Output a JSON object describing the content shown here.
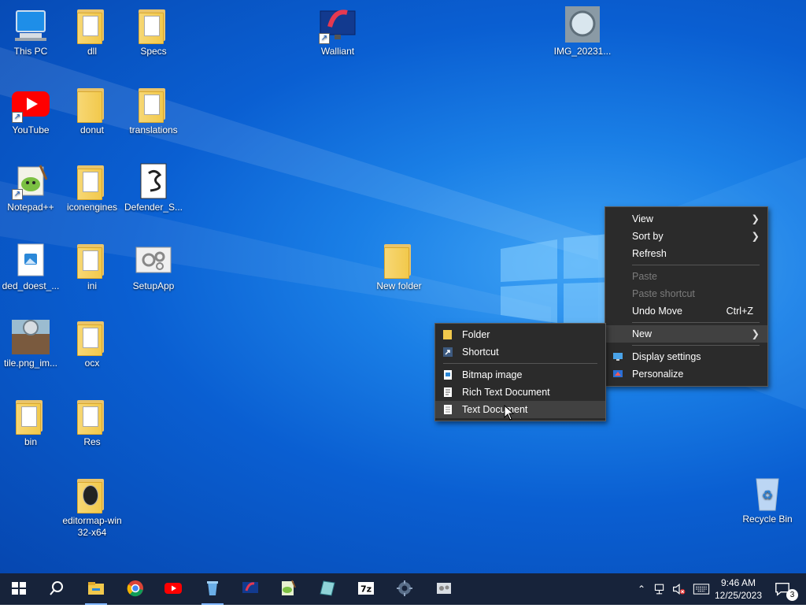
{
  "desktop": {
    "icons": [
      {
        "label": "This PC"
      },
      {
        "label": "dll"
      },
      {
        "label": "Specs"
      },
      {
        "label": "Walliant"
      },
      {
        "label": "IMG_20231..."
      },
      {
        "label": "YouTube"
      },
      {
        "label": "donut"
      },
      {
        "label": "translations"
      },
      {
        "label": "Notepad++"
      },
      {
        "label": "iconengines"
      },
      {
        "label": "Defender_S..."
      },
      {
        "label": "ded_doest_..."
      },
      {
        "label": "ini"
      },
      {
        "label": "SetupApp"
      },
      {
        "label": "New folder"
      },
      {
        "label": "tile.png_im..."
      },
      {
        "label": "ocx"
      },
      {
        "label": "bin"
      },
      {
        "label": "Res"
      },
      {
        "label": "editormap-win32-x64"
      },
      {
        "label": "Recycle Bin"
      }
    ]
  },
  "context_menu": {
    "items": [
      {
        "label": "View"
      },
      {
        "label": "Sort by"
      },
      {
        "label": "Refresh"
      },
      {
        "label": "Paste"
      },
      {
        "label": "Paste shortcut"
      },
      {
        "label": "Undo Move",
        "shortcut": "Ctrl+Z"
      },
      {
        "label": "New"
      },
      {
        "label": "Display settings"
      },
      {
        "label": "Personalize"
      }
    ]
  },
  "new_submenu": {
    "items": [
      {
        "label": "Folder"
      },
      {
        "label": "Shortcut"
      },
      {
        "label": "Bitmap image"
      },
      {
        "label": "Rich Text Document"
      },
      {
        "label": "Text Document"
      }
    ]
  },
  "taskbar": {
    "clock": {
      "time": "9:46 AM",
      "date": "12/25/2023"
    },
    "notification_count": "3",
    "apps": [
      "start-icon",
      "search-icon",
      "file-explorer-icon",
      "chrome-icon",
      "youtube-icon",
      "recycle-icon",
      "walliant-icon",
      "notepadpp-icon",
      "notes-icon",
      "7zip-icon",
      "settings-gear-icon",
      "app-icon"
    ]
  },
  "colors": {
    "taskbar": "#17233a",
    "menu_bg": "#2b2b2b",
    "menu_highlight": "#414141",
    "desktop_accent": "#0a5fd2"
  }
}
